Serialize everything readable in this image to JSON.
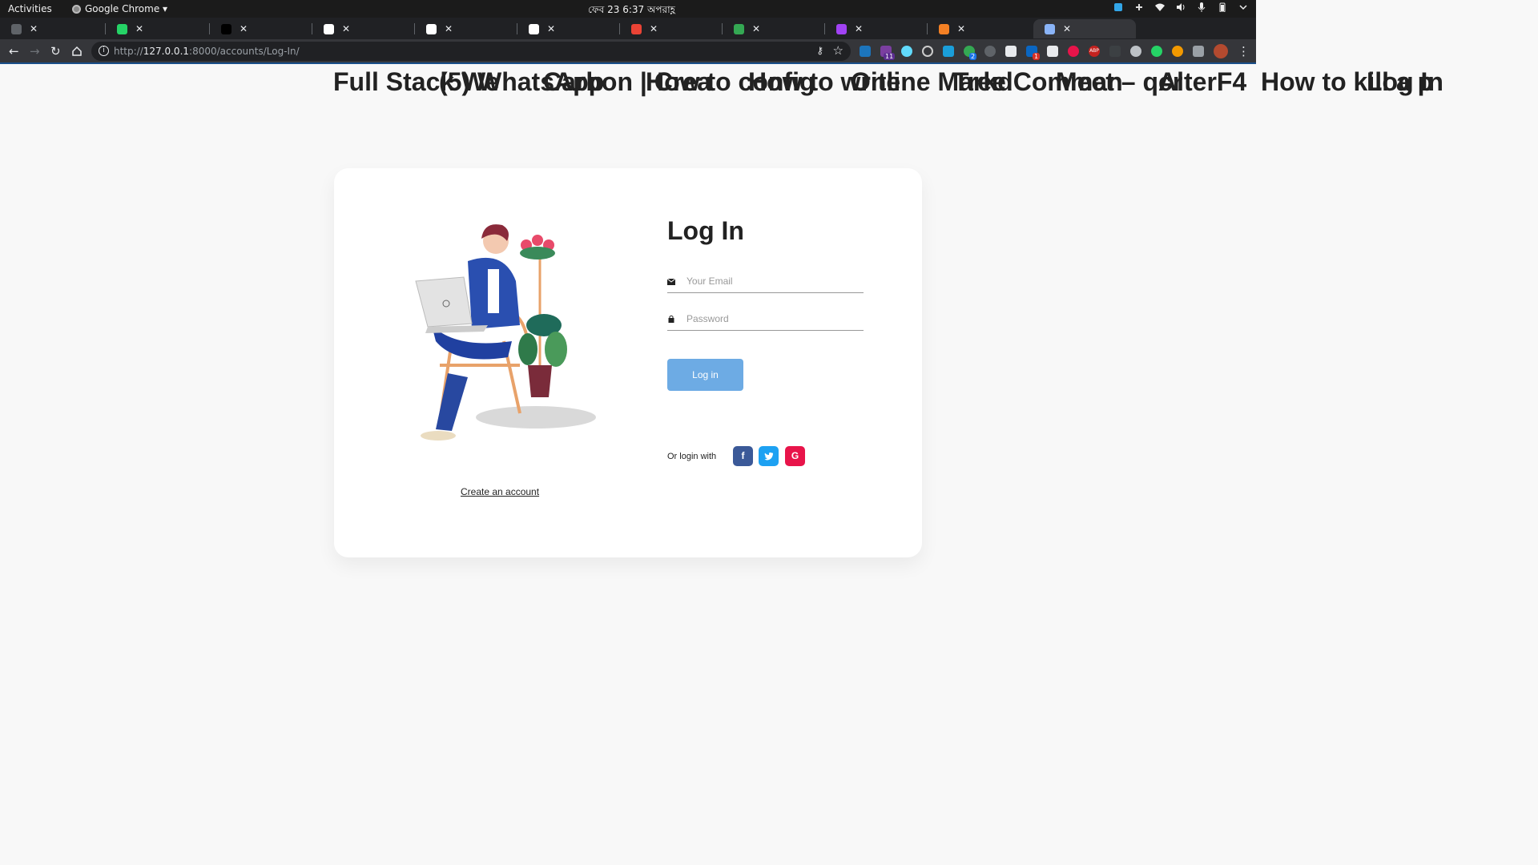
{
  "system_bar": {
    "activities": "Activities",
    "app_name": "Google Chrome ▾",
    "clock": "ফেব 23   6:37 অপরাহ্ণ"
  },
  "tabs": [
    {
      "title": "Full Stack We",
      "favicon_color": "#5f6368",
      "active": false
    },
    {
      "title": "(5) WhatsApp",
      "favicon_color": "#25d366",
      "active": false
    },
    {
      "title": "Carbon | Crea",
      "favicon_color": "#000000",
      "active": false
    },
    {
      "title": "How to config",
      "favicon_color": "#ffffff",
      "active": false
    },
    {
      "title": "How to write",
      "favicon_color": "#ffffff",
      "active": false
    },
    {
      "title": "Online Markd",
      "favicon_color": "#ffffff",
      "active": false
    },
    {
      "title": "Tree Comman",
      "favicon_color": "#ea4335",
      "active": false
    },
    {
      "title": "Meet – qcr",
      "favicon_color": "#34a853",
      "active": false
    },
    {
      "title": "AlterF4",
      "favicon_color": "#a142f4",
      "active": false
    },
    {
      "title": "How to kill a p",
      "favicon_color": "#f48024",
      "active": false
    },
    {
      "title": "Log In",
      "favicon_color": "#8ab4f8",
      "active": true
    }
  ],
  "address_bar": {
    "url_scheme": "http://",
    "url_host": "127.0.0.1",
    "url_rest": ":8000/accounts/Log-In/"
  },
  "extension_badges": {
    "first": "11",
    "second": "2",
    "third": "1",
    "abp": "ABP"
  },
  "login": {
    "title": "Log In",
    "email_placeholder": "Your Email",
    "password_placeholder": "Password",
    "button_label": "Log in",
    "social_label": "Or login with",
    "create_account": "Create an account",
    "social": [
      {
        "name": "facebook",
        "glyph": "f",
        "color": "#3b5998"
      },
      {
        "name": "twitter",
        "glyph": "t",
        "color": "#1da1f2"
      },
      {
        "name": "google",
        "glyph": "G",
        "color": "#e8144a"
      }
    ]
  },
  "colors": {
    "accent": "#6dabe4",
    "card": "#ffffff",
    "page": "#f8f8f8"
  }
}
